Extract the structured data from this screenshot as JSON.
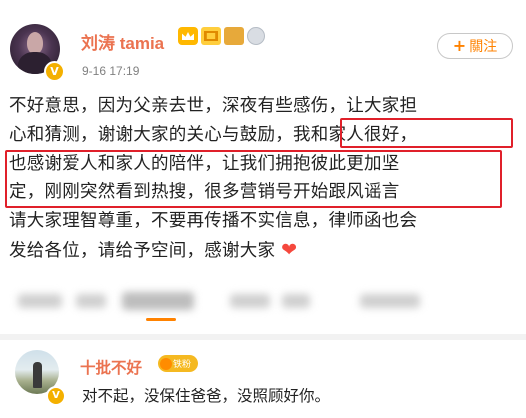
{
  "post": {
    "username": "刘涛 tamia",
    "timestamp": "9-16 17:19",
    "verified_mark": "V",
    "follow_plus": "+",
    "follow_label": "關注",
    "text_lines": [
      "不好意思，因为父亲去世，深夜有些感伤，让大家担",
      "心和猜测，谢谢大家的关心与鼓励，我和家人很好，",
      "也感谢爱人和家人的陪伴，让我们拥抱彼此更加坚",
      "定，刚刚突然看到热搜，很多营销号开始跟风谣言",
      "请大家理智尊重，不要再传播不实信息，律师函也会",
      "发给各位，请给予空间，感谢大家 "
    ],
    "heart_emoji": "❤",
    "highlight_color": "#e0202a"
  },
  "comment": {
    "username": "十批不好",
    "badge_label": "铁粉",
    "verified_mark": "V",
    "text": "对不起，没保住爸爸，没照顾好你。"
  },
  "colors": {
    "username": "#eb7350",
    "follow": "#ff8200",
    "verified": "#f4b000"
  }
}
